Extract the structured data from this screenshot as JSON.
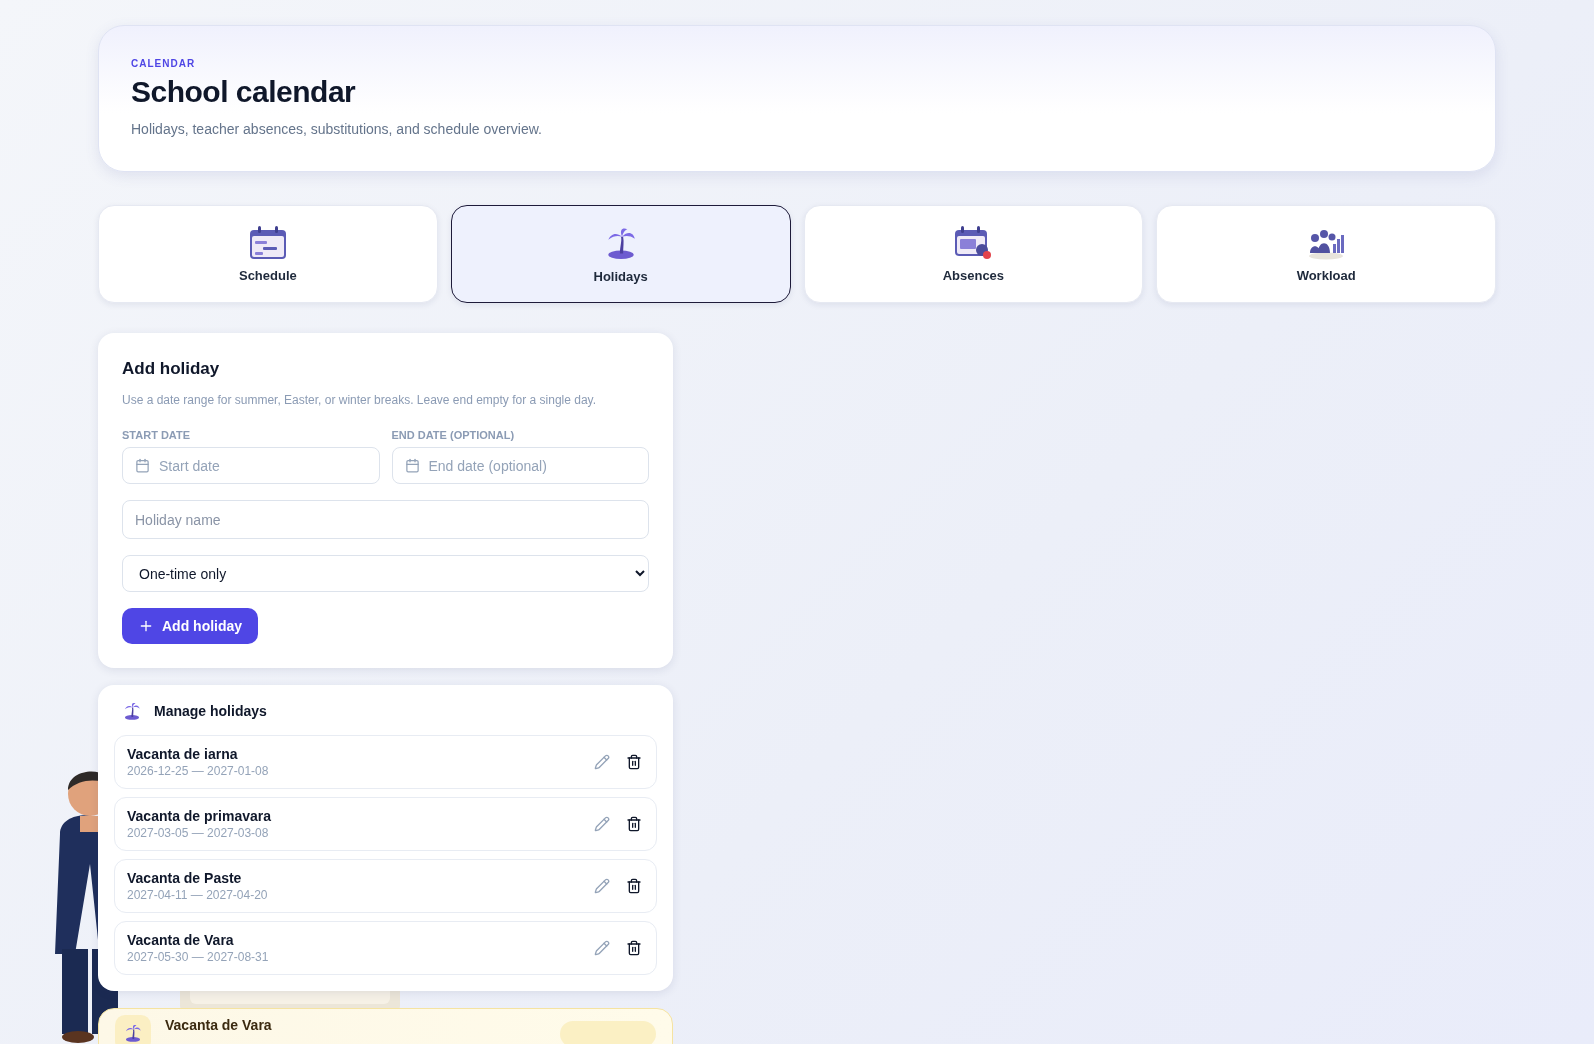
{
  "header": {
    "eyebrow": "CALENDAR",
    "title": "School calendar",
    "subtitle": "Holidays, teacher absences, substitutions, and schedule overview."
  },
  "tabs": [
    {
      "label": "Schedule",
      "selected": false
    },
    {
      "label": "Holidays",
      "selected": true
    },
    {
      "label": "Absences",
      "selected": false
    },
    {
      "label": "Workload",
      "selected": false
    }
  ],
  "add_holiday": {
    "title": "Add holiday",
    "hint": "Use a date range for summer, Easter, or winter breaks. Leave end empty for a single day.",
    "start_label": "START DATE",
    "start_placeholder": "Start date",
    "end_label": "END DATE (OPTIONAL)",
    "end_placeholder": "End date (optional)",
    "name_placeholder": "Holiday name",
    "repeat": "One-time only",
    "button": "Add holiday"
  },
  "manage": {
    "title": "Manage holidays",
    "items": [
      {
        "name": "Vacanta de iarna",
        "dates": "2026-12-25 — 2027-01-08"
      },
      {
        "name": "Vacanta de primavara",
        "dates": "2027-03-05 — 2027-03-08"
      },
      {
        "name": "Vacanta de Paste",
        "dates": "2027-04-11 — 2027-04-20"
      },
      {
        "name": "Vacanta de Vara",
        "dates": "2027-05-30 — 2027-08-31"
      }
    ]
  },
  "upcoming": {
    "name": "Vacanta de Vara"
  }
}
